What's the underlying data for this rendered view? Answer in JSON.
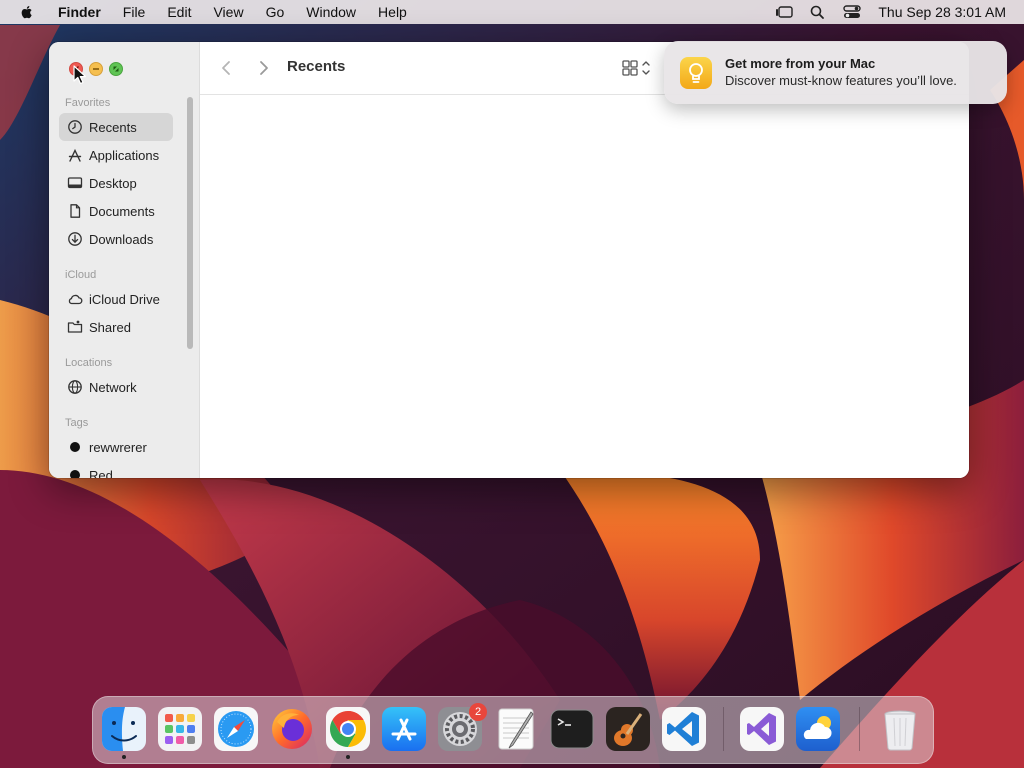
{
  "menubar": {
    "app_name": "Finder",
    "items": [
      "File",
      "Edit",
      "View",
      "Go",
      "Window",
      "Help"
    ],
    "clock": "Thu Sep 28  3:01 AM"
  },
  "finder": {
    "title": "Recents",
    "sidebar": {
      "sections": {
        "favorites": "Favorites",
        "icloud": "iCloud",
        "locations": "Locations",
        "tags": "Tags"
      },
      "favorites": [
        "Recents",
        "Applications",
        "Desktop",
        "Documents",
        "Downloads"
      ],
      "icloud_items": [
        "iCloud Drive",
        "Shared"
      ],
      "locations_items": [
        "Network"
      ],
      "tags_items": [
        "rewwrerer",
        "Red"
      ]
    }
  },
  "notification": {
    "title": "Get more from your Mac",
    "body": "Discover must-know features you’ll love."
  },
  "dock": {
    "apps": [
      "finder-icon",
      "launchpad-icon",
      "safari-icon",
      "firefox-icon",
      "chrome-icon",
      "app-store-icon",
      "system-settings-icon",
      "textedit-icon",
      "terminal-icon",
      "garageband-icon",
      "vscode-icon",
      "visual-studio-icon",
      "weather-icon",
      "trash-icon"
    ],
    "settings_badge": "2"
  },
  "colors": {
    "accent": "#0a7aff",
    "close": "#ee5a52",
    "minimize": "#f5bf4f",
    "zoom": "#5fc454"
  }
}
